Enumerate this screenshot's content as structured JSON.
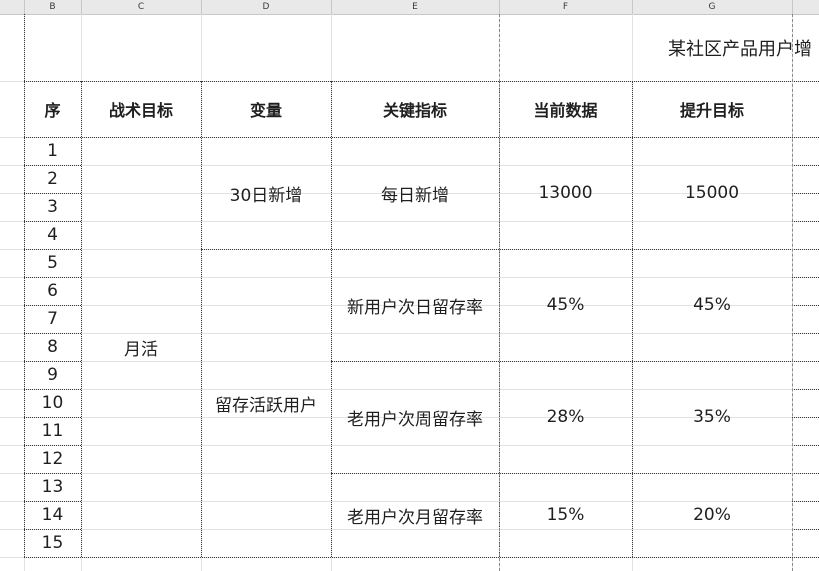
{
  "column_headers": [
    "B",
    "C",
    "D",
    "E",
    "F",
    "G"
  ],
  "title": "某社区产品用户增",
  "table_headers": {
    "index": "序",
    "goal": "战术目标",
    "variable": "变量",
    "metric": "关键指标",
    "current": "当前数据",
    "target": "提升目标"
  },
  "row_numbers": [
    "1",
    "2",
    "3",
    "4",
    "5",
    "6",
    "7",
    "8",
    "9",
    "10",
    "11",
    "12",
    "13",
    "14",
    "15"
  ],
  "goal": "月活",
  "variables": [
    "30日新增",
    "留存活跃用户"
  ],
  "rows": [
    {
      "metric": "每日新增",
      "current": "13000",
      "target": "15000"
    },
    {
      "metric": "新用户次日留存率",
      "current": "45%",
      "target": "45%"
    },
    {
      "metric": "老用户次周留存率",
      "current": "28%",
      "target": "35%"
    },
    {
      "metric": "老用户次月留存率",
      "current": "15%",
      "target": "20%"
    }
  ]
}
